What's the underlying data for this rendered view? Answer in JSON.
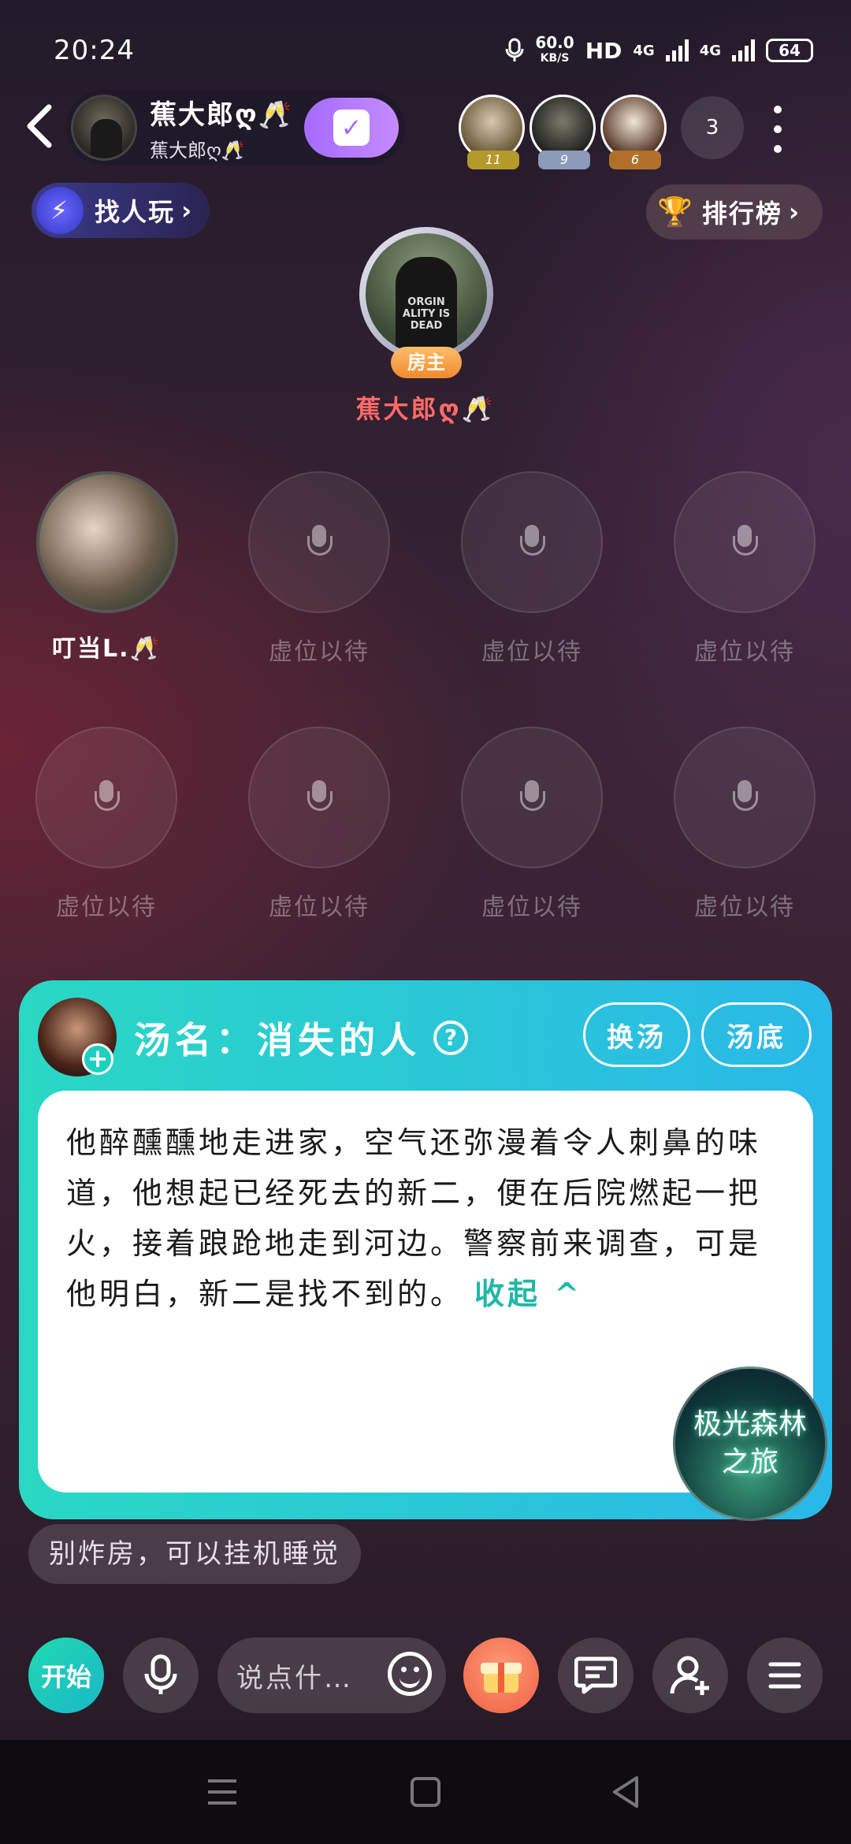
{
  "status": {
    "time": "20:24",
    "speed_value": "60.0",
    "speed_unit": "KB/S",
    "hd": "HD",
    "net1": "4G",
    "net2": "4G",
    "battery": "64"
  },
  "header": {
    "room_name": "蕉大郎ღ🥂",
    "room_sub": "蕉大郎ღ🥂",
    "top_users": [
      {
        "badge": "11",
        "color": "#b39a2a"
      },
      {
        "badge": "9",
        "color": "#8a9ab8"
      },
      {
        "badge": "6",
        "color": "#b0702a"
      }
    ],
    "online_count": "3"
  },
  "actions": {
    "find_label": "找人玩",
    "rank_label": "排行榜"
  },
  "host": {
    "badge": "房主",
    "name": "蕉大郎ღ🥂",
    "shirt_text": "ORGIN ALITY IS DEAD"
  },
  "seats": {
    "occupied_name": "叮当L.🥂",
    "empty_label": "虚位以待"
  },
  "card": {
    "title": "汤名：消失的人",
    "swap_label": "换汤",
    "answer_label": "汤底",
    "story": "他醉醺醺地走进家，空气还弥漫着令人刺鼻的味道，他想起已经死去的新二，便在后院燃起一把火，接着踉跄地走到河边。警察前来调查，可是他明白，新二是找不到的。",
    "collapse_label": "收起 ^",
    "badge_line1": "极光森林",
    "badge_line2": "之旅"
  },
  "tip": "别炸房，可以挂机睡觉",
  "bottom": {
    "start_label": "开始",
    "input_placeholder": "说点什…"
  }
}
